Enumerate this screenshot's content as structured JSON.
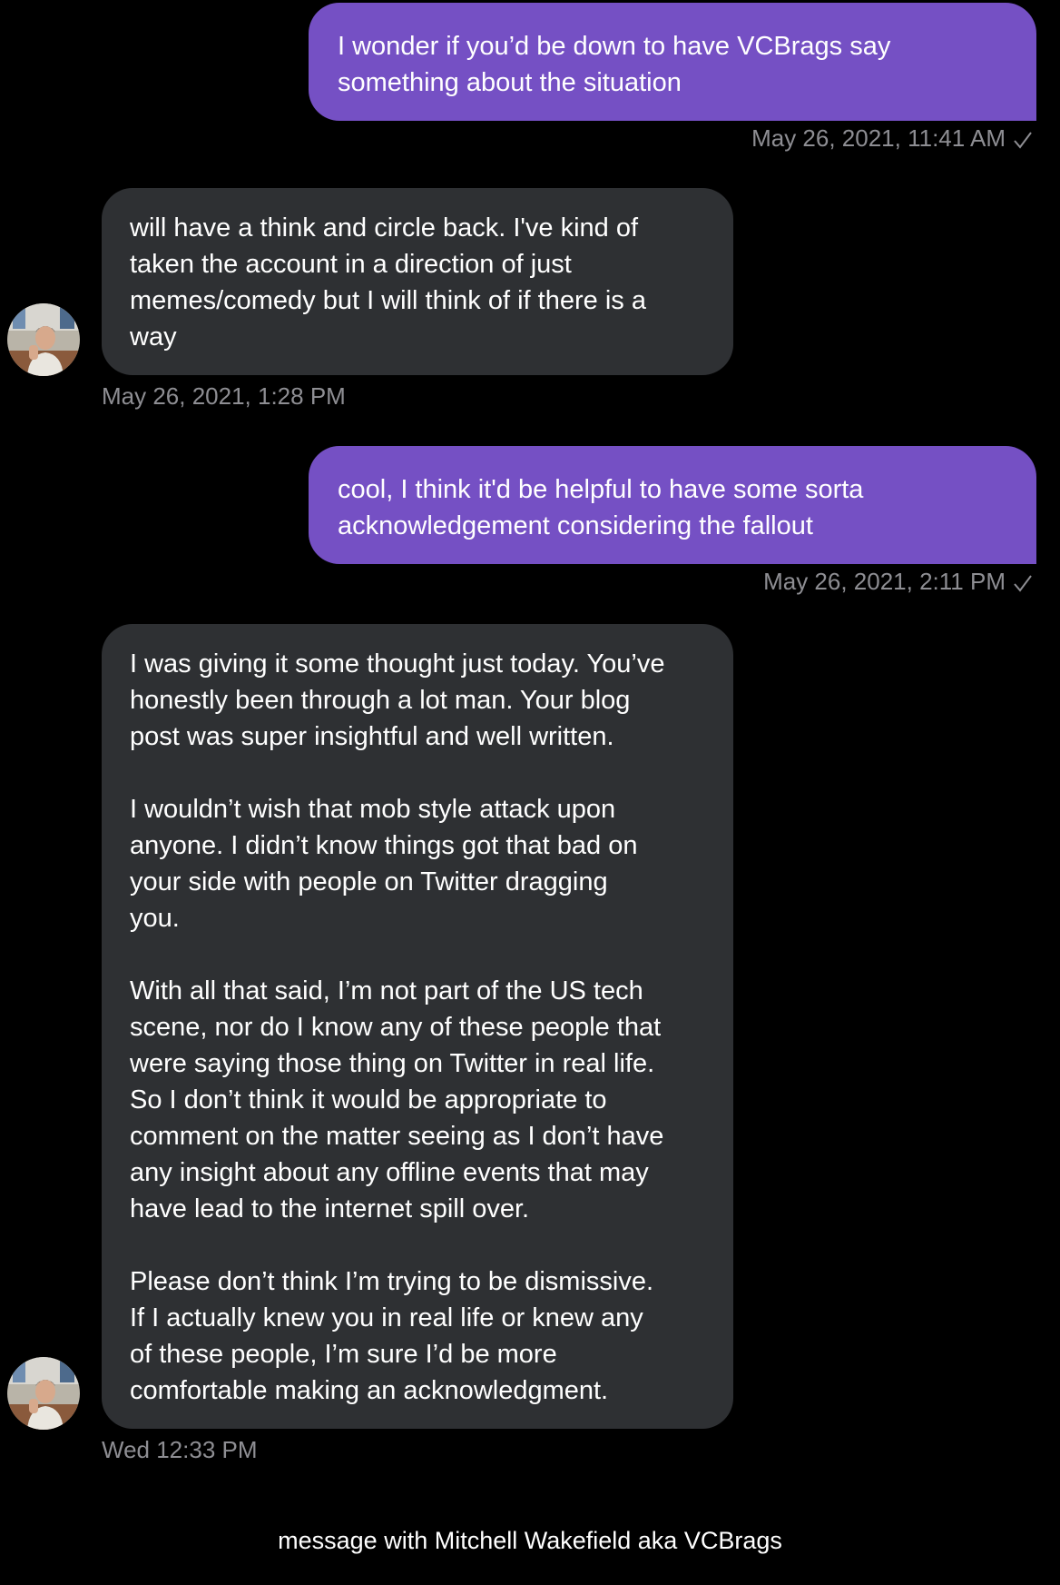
{
  "conversation": {
    "messages": [
      {
        "direction": "sent",
        "paragraphs": [
          "I wonder if you’d be down to have VCBrags say\nsomething about the situation"
        ],
        "timestamp": "May 26, 2021, 11:41 AM"
      },
      {
        "direction": "received",
        "paragraphs": [
          "will have a think and circle back. I've kind of\ntaken the account in a direction of just\nmemes/comedy but I will think of if there is a\nway"
        ],
        "timestamp": "May 26, 2021, 1:28 PM"
      },
      {
        "direction": "sent",
        "paragraphs": [
          "cool, I think it'd be helpful to have some sorta\nacknowledgement considering the fallout"
        ],
        "timestamp": "May 26, 2021, 2:11 PM"
      },
      {
        "direction": "received",
        "paragraphs": [
          "I was giving it some thought just today. You’ve\nhonestly been through a lot man. Your blog\npost was super insightful and well written.",
          "I wouldn’t wish that mob style attack upon\nanyone. I didn’t know things got that bad on\nyour side with people on Twitter dragging\nyou.",
          "With all that said, I’m not part of the US tech\nscene, nor do I know any of these people that\nwere saying those thing on Twitter in real life.\nSo I don’t think it would be appropriate to\ncomment on the matter seeing as I don’t have\nany insight about any offline events that may\nhave lead to the internet spill over.",
          "Please don’t think I’m trying to be dismissive.\nIf I actually knew you in real life or knew any\nof these people, I’m sure I’d be more\ncomfortable making an acknowledgment."
        ],
        "timestamp": "Wed 12:33 PM"
      }
    ]
  },
  "caption": "message with Mitchell Wakefield aka VCBrags",
  "icons": {
    "read_receipt": "checkmark-icon",
    "contact_avatar": "avatar"
  },
  "colors": {
    "background": "#000000",
    "sent_bubble": "#7550c4",
    "received_bubble": "#2e3033",
    "timestamp_text": "#8e8e93"
  }
}
